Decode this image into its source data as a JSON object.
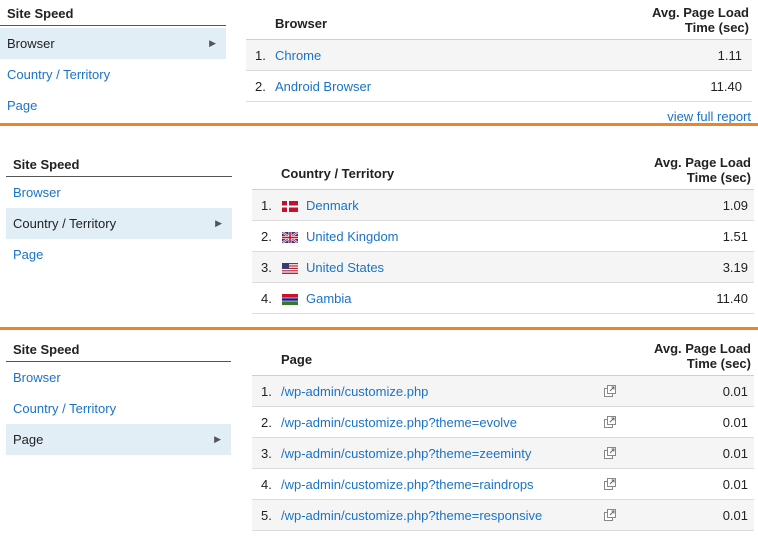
{
  "colors": {
    "accent": "#f0822a",
    "link": "#1a73c6",
    "selected_bg": "#e2eef6"
  },
  "panels": [
    {
      "nav": {
        "title": "Site Speed",
        "items": [
          {
            "label": "Browser",
            "selected": true
          },
          {
            "label": "Country / Territory",
            "selected": false
          },
          {
            "label": "Page",
            "selected": false
          }
        ]
      },
      "table": {
        "dimension_header": "Browser",
        "metric_header_line1": "Avg. Page Load",
        "metric_header_line2": "Time (sec)",
        "rows": [
          {
            "num": "1.",
            "label": "Chrome",
            "value": "1.11"
          },
          {
            "num": "2.",
            "label": "Android Browser",
            "value": "11.40"
          }
        ],
        "footer_link": "view full report"
      }
    },
    {
      "nav": {
        "title": "Site Speed",
        "items": [
          {
            "label": "Browser",
            "selected": false
          },
          {
            "label": "Country / Territory",
            "selected": true
          },
          {
            "label": "Page",
            "selected": false
          }
        ]
      },
      "table": {
        "dimension_header": "Country / Territory",
        "metric_header_line1": "Avg. Page Load",
        "metric_header_line2": "Time (sec)",
        "rows": [
          {
            "num": "1.",
            "label": "Denmark",
            "value": "1.09",
            "icon": "denmark-flag-icon"
          },
          {
            "num": "2.",
            "label": "United Kingdom",
            "value": "1.51",
            "icon": "united-kingdom-flag-icon"
          },
          {
            "num": "3.",
            "label": "United States",
            "value": "3.19",
            "icon": "united-states-flag-icon"
          },
          {
            "num": "4.",
            "label": "Gambia",
            "value": "11.40",
            "icon": "gambia-flag-icon"
          }
        ]
      }
    },
    {
      "nav": {
        "title": "Site Speed",
        "items": [
          {
            "label": "Browser",
            "selected": false
          },
          {
            "label": "Country / Territory",
            "selected": false
          },
          {
            "label": "Page",
            "selected": true
          }
        ]
      },
      "table": {
        "dimension_header": "Page",
        "metric_header_line1": "Avg. Page Load",
        "metric_header_line2": "Time (sec)",
        "rows": [
          {
            "num": "1.",
            "label": "/wp-admin/customize.php",
            "value": "0.01",
            "icon": "external-link-icon"
          },
          {
            "num": "2.",
            "label": "/wp-admin/customize.php?theme=evolve",
            "value": "0.01",
            "icon": "external-link-icon"
          },
          {
            "num": "3.",
            "label": "/wp-admin/customize.php?theme=zeeminty",
            "value": "0.01",
            "icon": "external-link-icon"
          },
          {
            "num": "4.",
            "label": "/wp-admin/customize.php?theme=raindrops",
            "value": "0.01",
            "icon": "external-link-icon"
          },
          {
            "num": "5.",
            "label": "/wp-admin/customize.php?theme=responsive",
            "value": "0.01",
            "icon": "external-link-icon"
          }
        ]
      }
    }
  ]
}
